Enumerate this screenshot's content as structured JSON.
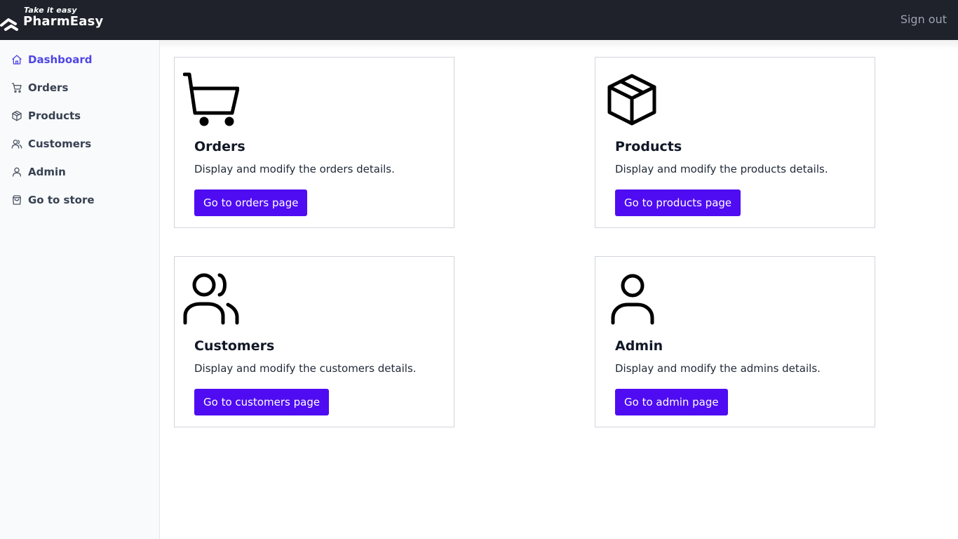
{
  "header": {
    "logo_tagline": "Take it easy",
    "logo_name": "PharmEasy",
    "sign_out_label": "Sign out"
  },
  "sidebar": {
    "items": [
      {
        "label": "Dashboard",
        "icon": "home-icon",
        "active": true
      },
      {
        "label": "Orders",
        "icon": "cart-icon",
        "active": false
      },
      {
        "label": "Products",
        "icon": "cube-icon",
        "active": false
      },
      {
        "label": "Customers",
        "icon": "users-icon",
        "active": false
      },
      {
        "label": "Admin",
        "icon": "user-icon",
        "active": false
      },
      {
        "label": "Go to store",
        "icon": "shopping-bag-icon",
        "active": false
      }
    ]
  },
  "cards": [
    {
      "title": "Orders",
      "description": "Display and modify the orders details.",
      "button_label": "Go to orders page",
      "icon": "cart-icon"
    },
    {
      "title": "Products",
      "description": "Display and modify the products details.",
      "button_label": "Go to products page",
      "icon": "cube-icon"
    },
    {
      "title": "Customers",
      "description": "Display and modify the customers details.",
      "button_label": "Go to customers page",
      "icon": "users-icon"
    },
    {
      "title": "Admin",
      "description": "Display and modify the admins details.",
      "button_label": "Go to admin page",
      "icon": "user-icon"
    }
  ],
  "colors": {
    "header_bg": "#1f222b",
    "accent": "#4f46e5",
    "button_bg": "#4f0cf2"
  }
}
